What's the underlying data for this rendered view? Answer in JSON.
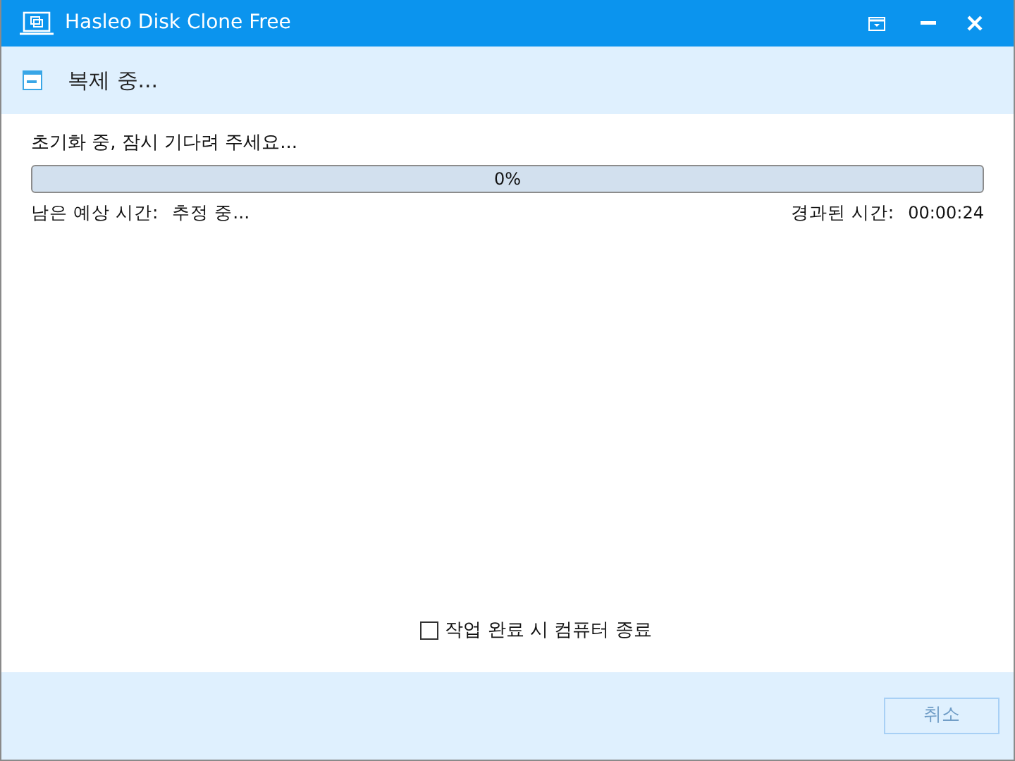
{
  "window": {
    "title": "Hasleo Disk Clone Free"
  },
  "header": {
    "title": "복제 중..."
  },
  "status": "초기화 중, 잠시 기다려 주세요...",
  "progress": {
    "level": 0,
    "text": "0%"
  },
  "remaining": {
    "label": "남은 예상 시간:",
    "value": "추정 중..."
  },
  "elapsed": {
    "label": "경과된 시간:",
    "value": "00:00:24"
  },
  "shutdown_option": {
    "label": "작업 완료 시 컴퓨터 종료",
    "checked": false
  },
  "cancel_button": {
    "label": "취소",
    "disabled": true
  }
}
